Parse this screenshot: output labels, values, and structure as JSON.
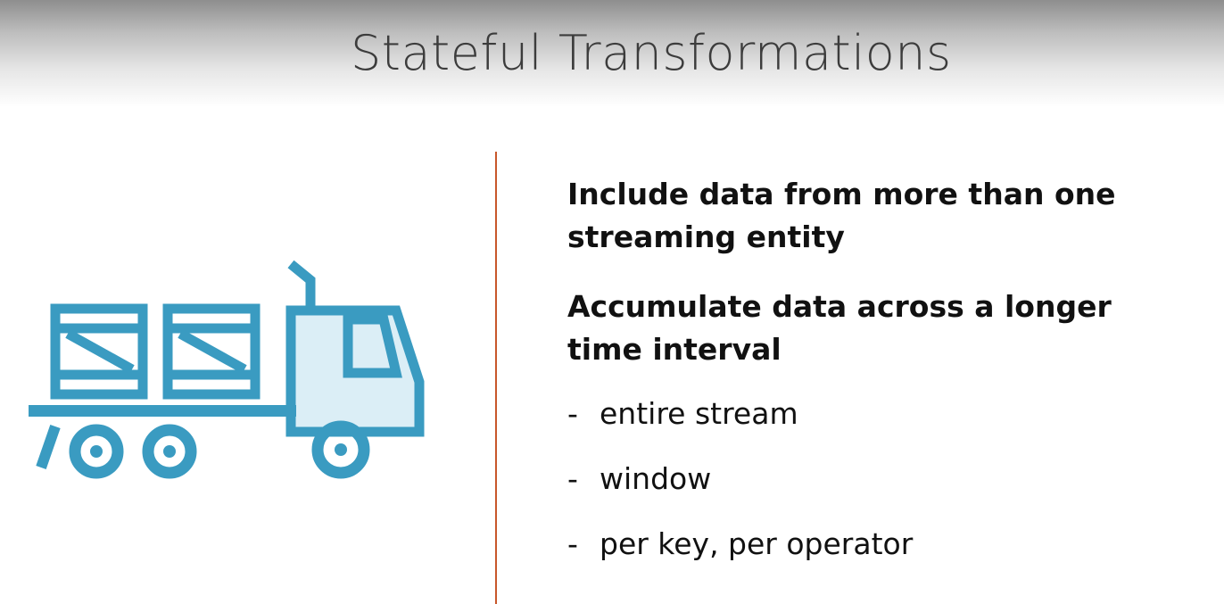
{
  "slide": {
    "title": "Stateful Transformations",
    "points": [
      "Include data from more than one streaming entity",
      "Accumulate data across a longer time interval"
    ],
    "sub_bullets": [
      "entire stream",
      "window",
      "per key, per operator"
    ],
    "bullet_marker": "-"
  },
  "icon": {
    "name": "delivery-truck-icon",
    "color": "#3a9bc1",
    "fill_color": "#dbeef6"
  },
  "accent_color": "#c8572a"
}
